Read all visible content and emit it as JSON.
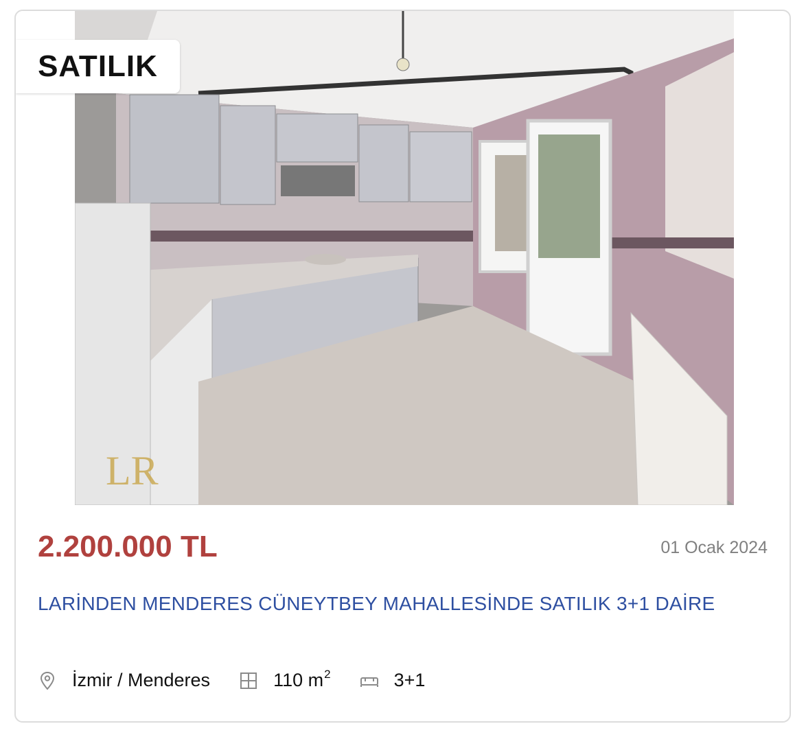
{
  "listing": {
    "status_badge": "SATILIK",
    "price": "2.200.000 TL",
    "date": "01 Ocak 2024",
    "title": "LARİNDEN MENDERES CÜNEYTBEY MAHALLESİNDE SATILIK 3+1 DAİRE",
    "location": "İzmir / Menderes",
    "area_value": "110 m",
    "area_unit_superscript": "2",
    "rooms": "3+1",
    "photo_icon": "kitchen-photo",
    "watermark_logo": "LR",
    "icons": {
      "location": "map-pin-icon",
      "area": "floorplan-icon",
      "rooms": "bed-icon"
    },
    "colors": {
      "price": "#b0413e",
      "title": "#2e4fa1",
      "date": "#808080"
    }
  }
}
